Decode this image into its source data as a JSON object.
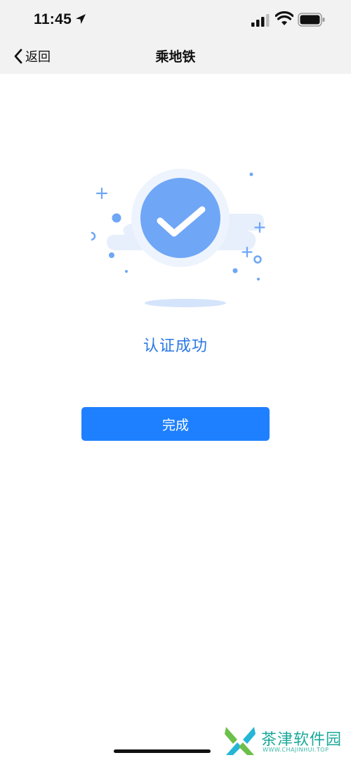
{
  "status_bar": {
    "time": "11:45",
    "icons": [
      "location-arrow-icon",
      "signal-icon",
      "wifi-icon",
      "battery-icon"
    ]
  },
  "nav": {
    "back_label": "返回",
    "title": "乘地铁"
  },
  "main": {
    "status_icon": "checkmark-icon",
    "success_text": "认证成功",
    "done_label": "完成"
  },
  "watermark": {
    "name": "茶津软件园",
    "url": "WWW.CHAJINHUI.TOP"
  },
  "colors": {
    "accent": "#1f80ff",
    "success_text": "#2a78e4",
    "check_circle": "#6fa6f6",
    "nav_background": "#f2f2f2"
  }
}
